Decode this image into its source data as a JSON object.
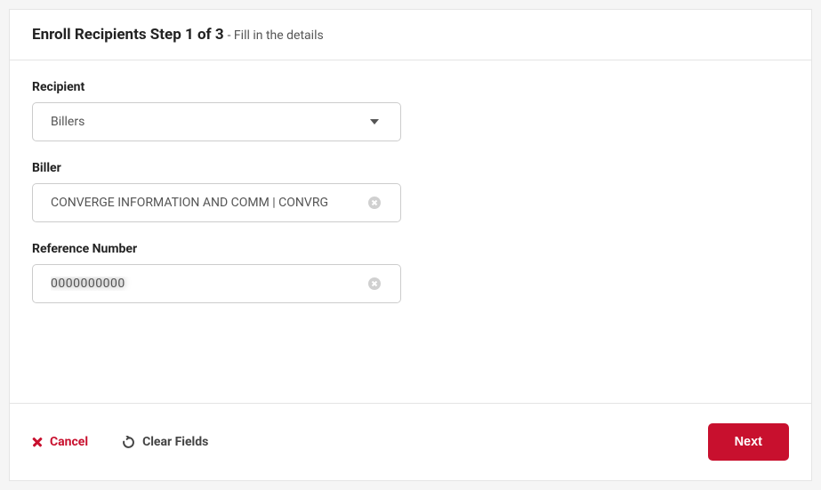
{
  "header": {
    "title": "Enroll Recipients Step 1 of 3",
    "subtitle": " - Fill in the details"
  },
  "form": {
    "recipient": {
      "label": "Recipient",
      "selected": "Billers"
    },
    "biller": {
      "label": "Biller",
      "value": "CONVERGE INFORMATION AND COMM | CONVRG"
    },
    "reference_number": {
      "label": "Reference Number",
      "value": "0000000000"
    }
  },
  "footer": {
    "cancel_label": "Cancel",
    "clear_label": "Clear Fields",
    "next_label": "Next"
  }
}
